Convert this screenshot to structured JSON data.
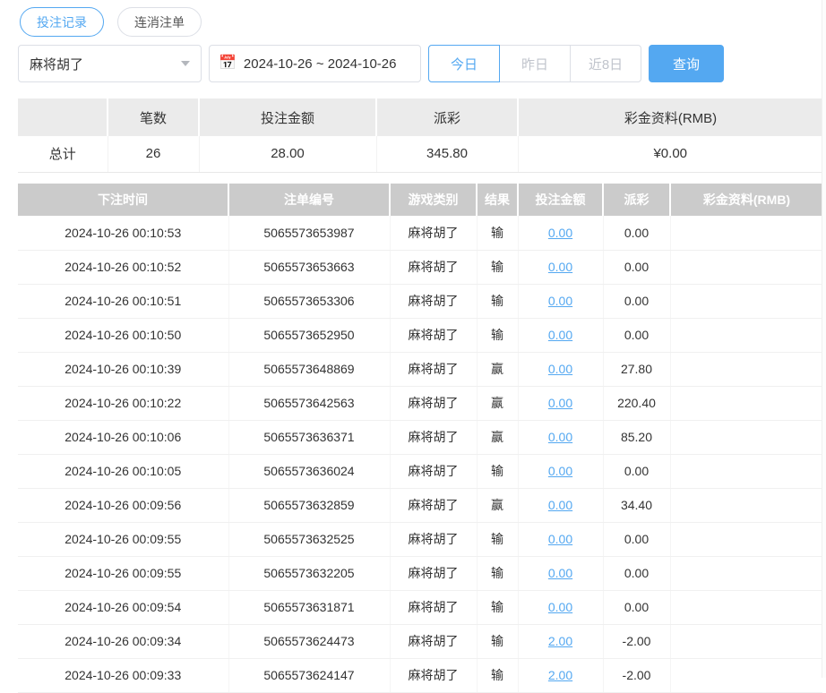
{
  "tabs": [
    {
      "label": "投注记录",
      "active": true
    },
    {
      "label": "连消注单",
      "active": false
    }
  ],
  "filters": {
    "game_select": {
      "value": "麻将胡了"
    },
    "date_range": "2024-10-26 ~ 2024-10-26",
    "quick_buttons": [
      {
        "label": "今日",
        "active": true
      },
      {
        "label": "昨日",
        "active": false
      },
      {
        "label": "近8日",
        "active": false
      }
    ],
    "query_label": "查询"
  },
  "summary": {
    "headers": [
      "",
      "笔数",
      "投注金额",
      "派彩",
      "彩金资料(RMB)"
    ],
    "total": {
      "label": "总计",
      "count": "26",
      "bet_amount": "28.00",
      "payout": "345.80",
      "bonus": "¥0.00"
    }
  },
  "table": {
    "headers": [
      "下注时间",
      "注单编号",
      "游戏类别",
      "结果",
      "投注金额",
      "派彩",
      "彩金资料(RMB)"
    ],
    "rows": [
      {
        "time": "2024-10-26 00:10:53",
        "order_no": "5065573653987",
        "game": "麻将胡了",
        "result": "输",
        "bet": "0.00",
        "payout": "0.00",
        "bonus": ""
      },
      {
        "time": "2024-10-26 00:10:52",
        "order_no": "5065573653663",
        "game": "麻将胡了",
        "result": "输",
        "bet": "0.00",
        "payout": "0.00",
        "bonus": ""
      },
      {
        "time": "2024-10-26 00:10:51",
        "order_no": "5065573653306",
        "game": "麻将胡了",
        "result": "输",
        "bet": "0.00",
        "payout": "0.00",
        "bonus": ""
      },
      {
        "time": "2024-10-26 00:10:50",
        "order_no": "5065573652950",
        "game": "麻将胡了",
        "result": "输",
        "bet": "0.00",
        "payout": "0.00",
        "bonus": ""
      },
      {
        "time": "2024-10-26 00:10:39",
        "order_no": "5065573648869",
        "game": "麻将胡了",
        "result": "赢",
        "bet": "0.00",
        "payout": "27.80",
        "bonus": ""
      },
      {
        "time": "2024-10-26 00:10:22",
        "order_no": "5065573642563",
        "game": "麻将胡了",
        "result": "赢",
        "bet": "0.00",
        "payout": "220.40",
        "bonus": ""
      },
      {
        "time": "2024-10-26 00:10:06",
        "order_no": "5065573636371",
        "game": "麻将胡了",
        "result": "赢",
        "bet": "0.00",
        "payout": "85.20",
        "bonus": ""
      },
      {
        "time": "2024-10-26 00:10:05",
        "order_no": "5065573636024",
        "game": "麻将胡了",
        "result": "输",
        "bet": "0.00",
        "payout": "0.00",
        "bonus": ""
      },
      {
        "time": "2024-10-26 00:09:56",
        "order_no": "5065573632859",
        "game": "麻将胡了",
        "result": "赢",
        "bet": "0.00",
        "payout": "34.40",
        "bonus": ""
      },
      {
        "time": "2024-10-26 00:09:55",
        "order_no": "5065573632525",
        "game": "麻将胡了",
        "result": "输",
        "bet": "0.00",
        "payout": "0.00",
        "bonus": ""
      },
      {
        "time": "2024-10-26 00:09:55",
        "order_no": "5065573632205",
        "game": "麻将胡了",
        "result": "输",
        "bet": "0.00",
        "payout": "0.00",
        "bonus": ""
      },
      {
        "time": "2024-10-26 00:09:54",
        "order_no": "5065573631871",
        "game": "麻将胡了",
        "result": "输",
        "bet": "0.00",
        "payout": "0.00",
        "bonus": ""
      },
      {
        "time": "2024-10-26 00:09:34",
        "order_no": "5065573624473",
        "game": "麻将胡了",
        "result": "输",
        "bet": "2.00",
        "payout": "-2.00",
        "bonus": ""
      },
      {
        "time": "2024-10-26 00:09:33",
        "order_no": "5065573624147",
        "game": "麻将胡了",
        "result": "输",
        "bet": "2.00",
        "payout": "-2.00",
        "bonus": ""
      }
    ]
  },
  "icons": {
    "calendar": "📅",
    "caret_down": "caret-down"
  },
  "colors": {
    "accent_blue": "#54a8f1",
    "header_gray": "#cbcbcb",
    "summary_header_gray": "#ebebeb",
    "negative_red": "#e15d5d",
    "muted_text": "#c0c4cc"
  }
}
